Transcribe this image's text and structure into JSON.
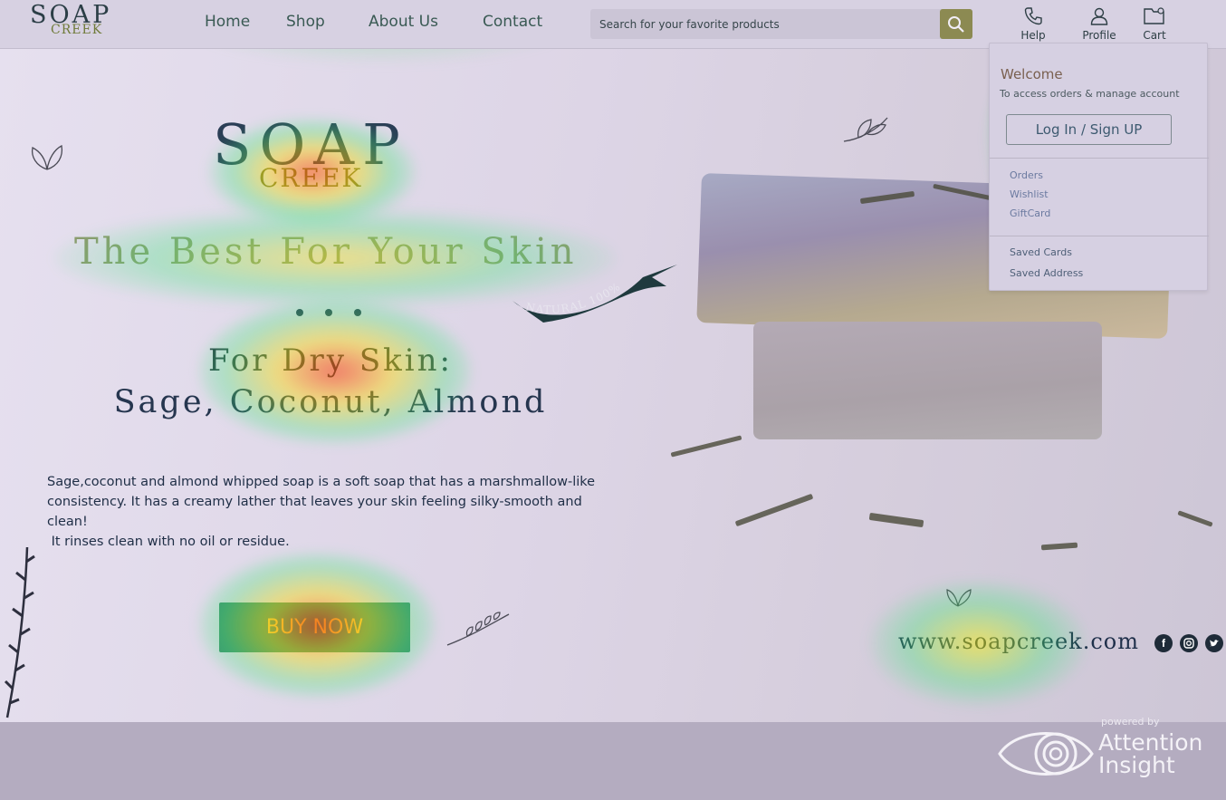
{
  "header": {
    "logo_main": "SOAP",
    "logo_sub": "CREEK",
    "nav": [
      "Home",
      "Shop",
      "About Us",
      "Contact"
    ],
    "search_placeholder": "Search for your favorite products",
    "help_label": "Help",
    "profile_label": "Profile",
    "cart_label": "Cart"
  },
  "dropdown": {
    "welcome": "Welcome",
    "description": "To access orders & manage account",
    "login_label": "Log In / Sign UP",
    "links_group1": [
      "Orders",
      "Wishlist",
      "GiftCard"
    ],
    "links_group2": [
      "Saved Cards",
      "Saved Address"
    ]
  },
  "hero": {
    "logo_main": "SOAP",
    "logo_sub": "CREEK",
    "tagline": "The Best For Your Skin",
    "badge": "NATURAL 100%",
    "dry_title": "For Dry Skin:",
    "dry_sub": "Sage, Coconut, Almond",
    "description_lines": [
      "Sage,coconut and almond whipped soap is a soft soap that has a marshmallow-like",
      "consistency. It has a creamy lather that leaves your skin feeling silky-smooth and",
      "clean!",
      " It rinses clean with no oil or residue."
    ],
    "buy_label": "BUY NOW",
    "website": "www.soapcreek.com"
  },
  "social": [
    "facebook-icon",
    "instagram-icon",
    "twitter-icon"
  ],
  "watermark": {
    "powered": "powered by",
    "brand_line1": "Attention",
    "brand_line2": "Insight"
  },
  "colors": {
    "accent": "#6f7a38",
    "button": "#3f8f6d",
    "text_dark": "#26364f"
  }
}
